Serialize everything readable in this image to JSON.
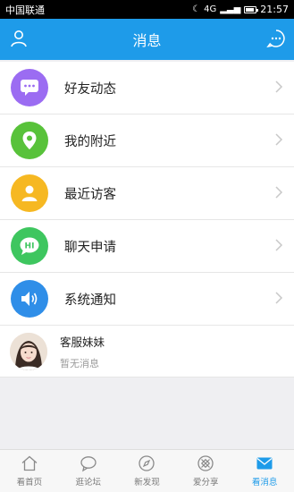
{
  "status": {
    "carrier": "中国联通",
    "signal": "4G",
    "time": "21:57"
  },
  "header": {
    "title": "消息"
  },
  "menu": [
    {
      "label": "好友动态",
      "icon": "chat-dots-icon",
      "color": "#9b6cf2"
    },
    {
      "label": "我的附近",
      "icon": "location-pin-icon",
      "color": "#58c23a"
    },
    {
      "label": "最近访客",
      "icon": "user-icon",
      "color": "#f6b822"
    },
    {
      "label": "聊天申请",
      "icon": "hi-bubble-icon",
      "color": "#3ec65f"
    },
    {
      "label": "系统通知",
      "icon": "speaker-icon",
      "color": "#2f8ee8"
    }
  ],
  "contact": {
    "name": "客服妹妹",
    "sub": "暂无消息"
  },
  "tabs": [
    {
      "label": "看首页",
      "icon": "home-icon"
    },
    {
      "label": "逛论坛",
      "icon": "forum-bubble-icon"
    },
    {
      "label": "新发现",
      "icon": "compass-icon"
    },
    {
      "label": "爱分享",
      "icon": "share-icon"
    },
    {
      "label": "看消息",
      "icon": "mail-icon",
      "active": true
    }
  ],
  "colors": {
    "accent": "#1e9be9"
  }
}
